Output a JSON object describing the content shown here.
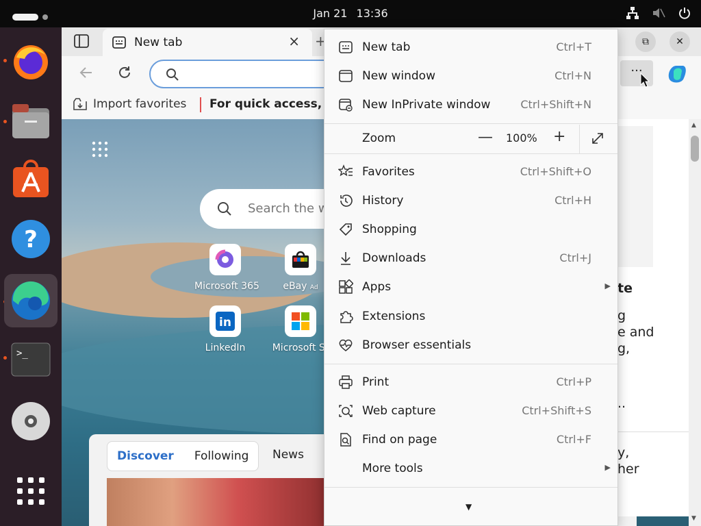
{
  "topbar": {
    "date": "Jan 21",
    "time": "13:36"
  },
  "dock": {
    "items": [
      "firefox",
      "files",
      "app-center",
      "help",
      "edge",
      "terminal",
      "disc",
      "app-grid"
    ]
  },
  "browser": {
    "tab": {
      "title": "New tab",
      "close": "×"
    },
    "newtab_symbol": "+",
    "win_restore": "⧉",
    "win_close": "✕",
    "more": "···",
    "favorites_bar": {
      "import_label": "Import favorites",
      "hint": "For quick access, pl"
    }
  },
  "ntp": {
    "search_placeholder": "Search the w",
    "tiles": [
      {
        "label": "Microsoft 365"
      },
      {
        "label": "eBay",
        "ad": "Ad"
      },
      {
        "label": "LinkedIn"
      },
      {
        "label": "Microsoft St"
      }
    ],
    "feed": {
      "discover": "Discover",
      "following": "Following",
      "news": "News"
    }
  },
  "right_panel": {
    "lines": [
      "te",
      "g",
      "e and",
      "g,",
      "..",
      "y,",
      "her"
    ]
  },
  "menu": {
    "items": [
      {
        "label": "New tab",
        "shortcut": "Ctrl+T"
      },
      {
        "label": "New window",
        "shortcut": "Ctrl+N"
      },
      {
        "label": "New InPrivate window",
        "shortcut": "Ctrl+Shift+N"
      },
      {
        "label": "Zoom",
        "value": "100%",
        "minus": "—",
        "plus": "+"
      },
      {
        "label": "Favorites",
        "shortcut": "Ctrl+Shift+O"
      },
      {
        "label": "History",
        "shortcut": "Ctrl+H"
      },
      {
        "label": "Shopping",
        "shortcut": ""
      },
      {
        "label": "Downloads",
        "shortcut": "Ctrl+J"
      },
      {
        "label": "Apps",
        "shortcut": ""
      },
      {
        "label": "Extensions",
        "shortcut": ""
      },
      {
        "label": "Browser essentials",
        "shortcut": ""
      },
      {
        "label": "Print",
        "shortcut": "Ctrl+P"
      },
      {
        "label": "Web capture",
        "shortcut": "Ctrl+Shift+S"
      },
      {
        "label": "Find on page",
        "shortcut": "Ctrl+F"
      },
      {
        "label": "More tools",
        "shortcut": ""
      }
    ]
  }
}
